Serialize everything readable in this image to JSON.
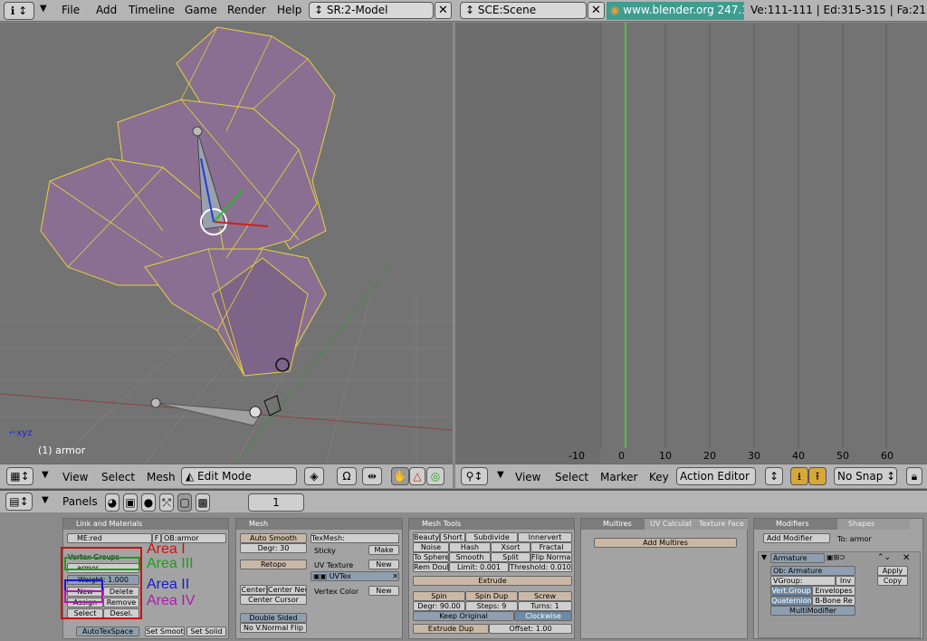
{
  "topbar": {
    "menus": [
      "File",
      "Add",
      "Timeline",
      "Game",
      "Render",
      "Help"
    ],
    "screen": "SR:2-Model",
    "scene": "SCE:Scene",
    "url": "www.blender.org 247.1",
    "stats": "Ve:111-111 | Ed:315-315 | Fa:21"
  },
  "viewport": {
    "object_label": "(1) armor",
    "menus": [
      "View",
      "Select",
      "Mesh"
    ],
    "mode": "Edit Mode"
  },
  "timeline": {
    "ticks": [
      "-10",
      "0",
      "10",
      "20",
      "30",
      "40",
      "50",
      "60"
    ],
    "menus": [
      "View",
      "Select",
      "Marker",
      "Key"
    ],
    "editor": "Action Editor",
    "snap": "No Snap"
  },
  "panels_bar": {
    "label": "Panels",
    "frame": "1"
  },
  "link_materials": {
    "title": "Link and Materials",
    "me": "ME:red",
    "f": "F",
    "ob": "OB:armor",
    "vgroups_label": "Vertex Groups",
    "group_name": "armor",
    "weight": "Weight: 1.000",
    "new": "New",
    "delete": "Delete",
    "assign": "Assign",
    "remove": "Remove",
    "select": "Select",
    "desel": "Desel.",
    "autotex": "AutoTexSpace",
    "set_smooth": "Set Smoot",
    "set_solid": "Set Solid"
  },
  "annotations": {
    "area1": "Area I",
    "area2": "Area II",
    "area3": "Area III",
    "area4": "Area IV",
    "color_red": "#cc1010",
    "color_green": "#18a018",
    "color_blue": "#1818c8",
    "color_magenta": "#b018b0"
  },
  "mesh": {
    "title": "Mesh",
    "auto_smooth": "Auto Smooth",
    "degr": "Degr: 30",
    "retopo": "Retopo",
    "center": "Center",
    "center_new": "Center New",
    "center_cursor": "Center Cursor",
    "double_sided": "Double Sided",
    "no_vnormal": "No V.Normal Flip",
    "texmesh": "TexMesh:",
    "sticky": "Sticky",
    "make": "Make",
    "uv_texture": "UV Texture",
    "new": "New",
    "uvtex": "UVTex",
    "vertex_color": "Vertex Color",
    "new2": "New"
  },
  "mesh_tools": {
    "title": "Mesh Tools",
    "row1": [
      "Beauty",
      "Short",
      "Subdivide",
      "Innervert"
    ],
    "row2": [
      "Noise",
      "Hash",
      "Xsort",
      "Fractal"
    ],
    "row3": [
      "To Sphere",
      "Smooth",
      "Split",
      "Flip Normal"
    ],
    "rem_doubles": "Rem Doubl",
    "limit": "Limit: 0.001",
    "threshold": "Threshold: 0.010",
    "extrude": "Extrude",
    "spin": "Spin",
    "spin_dup": "Spin Dup",
    "screw": "Screw",
    "degr90": "Degr: 90.00",
    "steps": "Steps: 9",
    "turns": "Turns: 1",
    "keep_original": "Keep Original",
    "clockwise": "Clockwise",
    "extrude_dup": "Extrude Dup",
    "offset": "Offset: 1.00"
  },
  "multires": {
    "tabs": [
      "Multires",
      "UV Calculat",
      "Texture Face"
    ],
    "add": "Add Multires"
  },
  "modifiers": {
    "tabs": [
      "Modifiers",
      "Shapes"
    ],
    "add": "Add Modifier",
    "to": "To: armor",
    "name": "Armature",
    "ob": "Ob: Armature",
    "vgroup": "VGroup:",
    "inv": "Inv",
    "vert_group": "Vert.Group",
    "envelopes": "Envelopes",
    "quaternion": "Quaternion",
    "bbone": "B-Bone Re",
    "multimodifier": "MultiModifier",
    "apply": "Apply",
    "copy": "Copy"
  }
}
